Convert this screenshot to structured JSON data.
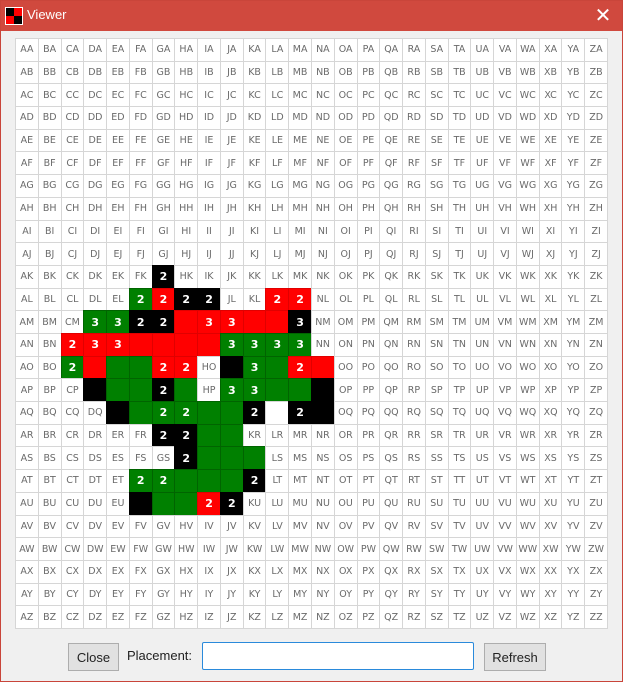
{
  "window": {
    "title": "Viewer",
    "close_icon": "close-x-icon",
    "app_icon": "red-black-squares-icon"
  },
  "grid": {
    "columns": [
      "A",
      "B",
      "C",
      "D",
      "E",
      "F",
      "G",
      "H",
      "I",
      "J",
      "K",
      "L",
      "M",
      "N",
      "O",
      "P",
      "Q",
      "R",
      "S",
      "T",
      "U",
      "V",
      "W",
      "X",
      "Y",
      "Z"
    ],
    "rows": [
      "A",
      "B",
      "C",
      "D",
      "E",
      "F",
      "G",
      "H",
      "I",
      "J",
      "K",
      "L",
      "M",
      "N",
      "O",
      "P",
      "Q",
      "R",
      "S",
      "T",
      "U",
      "V",
      "W",
      "X",
      "Y",
      "Z"
    ],
    "colors": {
      "black": "#000000",
      "red": "#ff0000",
      "green": "#008000"
    },
    "filled_cells": [
      {
        "cell": "GK",
        "color": "black",
        "value": "2"
      },
      {
        "cell": "FL",
        "color": "green",
        "value": "2"
      },
      {
        "cell": "GL",
        "color": "red",
        "value": "2"
      },
      {
        "cell": "HL",
        "color": "black",
        "value": "2"
      },
      {
        "cell": "IL",
        "color": "black",
        "value": "2"
      },
      {
        "cell": "LL",
        "color": "red",
        "value": "2"
      },
      {
        "cell": "ML",
        "color": "red",
        "value": "2"
      },
      {
        "cell": "DM",
        "color": "green",
        "value": "3"
      },
      {
        "cell": "EM",
        "color": "green",
        "value": "3"
      },
      {
        "cell": "FM",
        "color": "black",
        "value": "2"
      },
      {
        "cell": "GM",
        "color": "black",
        "value": "2"
      },
      {
        "cell": "HM",
        "color": "red",
        "value": ""
      },
      {
        "cell": "IM",
        "color": "red",
        "value": "3"
      },
      {
        "cell": "JM",
        "color": "red",
        "value": "3"
      },
      {
        "cell": "KM",
        "color": "red",
        "value": ""
      },
      {
        "cell": "LM",
        "color": "red",
        "value": ""
      },
      {
        "cell": "MM",
        "color": "black",
        "value": "3"
      },
      {
        "cell": "CN",
        "color": "red",
        "value": "2"
      },
      {
        "cell": "DN",
        "color": "red",
        "value": "3"
      },
      {
        "cell": "EN",
        "color": "red",
        "value": "3"
      },
      {
        "cell": "FN",
        "color": "red",
        "value": ""
      },
      {
        "cell": "GN",
        "color": "red",
        "value": ""
      },
      {
        "cell": "HN",
        "color": "red",
        "value": ""
      },
      {
        "cell": "IN",
        "color": "red",
        "value": ""
      },
      {
        "cell": "JN",
        "color": "green",
        "value": "3"
      },
      {
        "cell": "KN",
        "color": "green",
        "value": "3"
      },
      {
        "cell": "LN",
        "color": "green",
        "value": "3"
      },
      {
        "cell": "MN",
        "color": "green",
        "value": "3"
      },
      {
        "cell": "CO",
        "color": "green",
        "value": "2"
      },
      {
        "cell": "DO",
        "color": "red",
        "value": ""
      },
      {
        "cell": "EO",
        "color": "green",
        "value": ""
      },
      {
        "cell": "FO",
        "color": "green",
        "value": ""
      },
      {
        "cell": "GO",
        "color": "red",
        "value": "2"
      },
      {
        "cell": "HO",
        "color": "red",
        "value": "2"
      },
      {
        "cell": "IO",
        "color": "plain",
        "value": "HO"
      },
      {
        "cell": "JO",
        "color": "black",
        "value": ""
      },
      {
        "cell": "KO",
        "color": "green",
        "value": "3"
      },
      {
        "cell": "LO",
        "color": "green",
        "value": ""
      },
      {
        "cell": "MO",
        "color": "red",
        "value": "2"
      },
      {
        "cell": "NO",
        "color": "red",
        "value": ""
      },
      {
        "cell": "DP",
        "color": "black",
        "value": ""
      },
      {
        "cell": "EP",
        "color": "green",
        "value": ""
      },
      {
        "cell": "FP",
        "color": "green",
        "value": ""
      },
      {
        "cell": "GP",
        "color": "black",
        "value": "2"
      },
      {
        "cell": "HP",
        "color": "green",
        "value": ""
      },
      {
        "cell": "IP",
        "color": "plain",
        "value": "HP"
      },
      {
        "cell": "JP",
        "color": "green",
        "value": "3"
      },
      {
        "cell": "KP",
        "color": "green",
        "value": "3"
      },
      {
        "cell": "LP",
        "color": "green",
        "value": ""
      },
      {
        "cell": "MP",
        "color": "green",
        "value": ""
      },
      {
        "cell": "NP",
        "color": "black",
        "value": ""
      },
      {
        "cell": "EQ",
        "color": "black",
        "value": ""
      },
      {
        "cell": "FQ",
        "color": "green",
        "value": ""
      },
      {
        "cell": "GQ",
        "color": "green",
        "value": "2"
      },
      {
        "cell": "HQ",
        "color": "green",
        "value": "2"
      },
      {
        "cell": "IQ",
        "color": "green",
        "value": ""
      },
      {
        "cell": "JQ",
        "color": "green",
        "value": ""
      },
      {
        "cell": "KQ",
        "color": "black",
        "value": "2"
      },
      {
        "cell": "LQ",
        "color": "plain",
        "value": ""
      },
      {
        "cell": "MQ",
        "color": "black",
        "value": "2"
      },
      {
        "cell": "NQ",
        "color": "black",
        "value": ""
      },
      {
        "cell": "GR",
        "color": "black",
        "value": "2"
      },
      {
        "cell": "HR",
        "color": "black",
        "value": "2"
      },
      {
        "cell": "IR",
        "color": "green",
        "value": ""
      },
      {
        "cell": "JR",
        "color": "green",
        "value": ""
      },
      {
        "cell": "HS",
        "color": "black",
        "value": "2"
      },
      {
        "cell": "IS",
        "color": "green",
        "value": ""
      },
      {
        "cell": "JS",
        "color": "green",
        "value": ""
      },
      {
        "cell": "KS",
        "color": "green",
        "value": ""
      },
      {
        "cell": "FT",
        "color": "green",
        "value": "2"
      },
      {
        "cell": "GT",
        "color": "green",
        "value": "2"
      },
      {
        "cell": "HT",
        "color": "green",
        "value": ""
      },
      {
        "cell": "IT",
        "color": "green",
        "value": ""
      },
      {
        "cell": "JT",
        "color": "green",
        "value": ""
      },
      {
        "cell": "KT",
        "color": "black",
        "value": "2"
      },
      {
        "cell": "FU",
        "color": "black",
        "value": ""
      },
      {
        "cell": "GU",
        "color": "green",
        "value": ""
      },
      {
        "cell": "HU",
        "color": "green",
        "value": ""
      },
      {
        "cell": "IU",
        "color": "red",
        "value": "2"
      },
      {
        "cell": "JU",
        "color": "black",
        "value": "2"
      }
    ]
  },
  "footer": {
    "close_label": "Close",
    "placement_label": "Placement:",
    "placement_value": "",
    "refresh_label": "Refresh"
  }
}
